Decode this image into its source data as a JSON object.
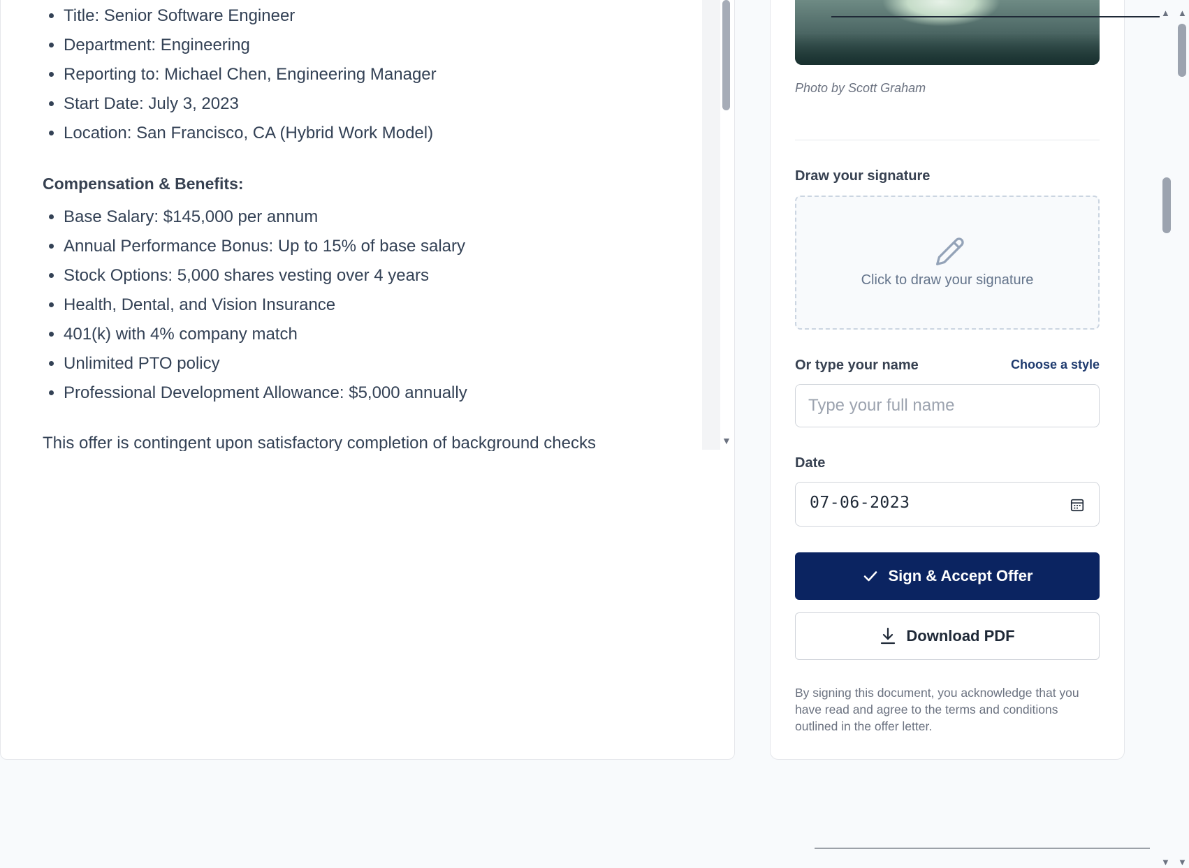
{
  "document": {
    "position_items": [
      "Title: Senior Software Engineer",
      "Department: Engineering",
      "Reporting to: Michael Chen, Engineering Manager",
      "Start Date: July 3, 2023",
      "Location: San Francisco, CA (Hybrid Work Model)"
    ],
    "compensation_heading": "Compensation & Benefits:",
    "compensation_items": [
      "Base Salary: $145,000 per annum",
      "Annual Performance Bonus: Up to 15% of base salary",
      "Stock Options: 5,000 shares vesting over 4 years",
      "Health, Dental, and Vision Insurance",
      "401(k) with 4% company match",
      "Unlimited PTO policy",
      "Professional Development Allowance: $5,000 annually"
    ],
    "tail_paragraph": "This offer is contingent upon satisfactory completion of background checks"
  },
  "signing": {
    "photo_credit": "Photo by Scott Graham",
    "draw_label": "Draw your signature",
    "draw_prompt": "Click to draw your signature",
    "type_label": "Or type your name",
    "style_link": "Choose a style",
    "name_placeholder": "Type your full name",
    "name_value": "",
    "date_label": "Date",
    "date_value": "07-06-2023",
    "sign_button": "Sign & Accept Offer",
    "download_button": "Download PDF",
    "legal_text": "By signing this document, you acknowledge that you have read and agree to the terms and conditions outlined in the offer letter."
  },
  "icons": {
    "signature_pad": "pencil-icon",
    "date": "calendar-icon",
    "sign": "check-icon",
    "download": "download-icon"
  },
  "colors": {
    "primary": "#0b2461",
    "link": "#1e3a6e",
    "text": "#334155",
    "muted": "#6b7280",
    "border": "#d1d5db",
    "page_bg": "#f8fafc"
  }
}
